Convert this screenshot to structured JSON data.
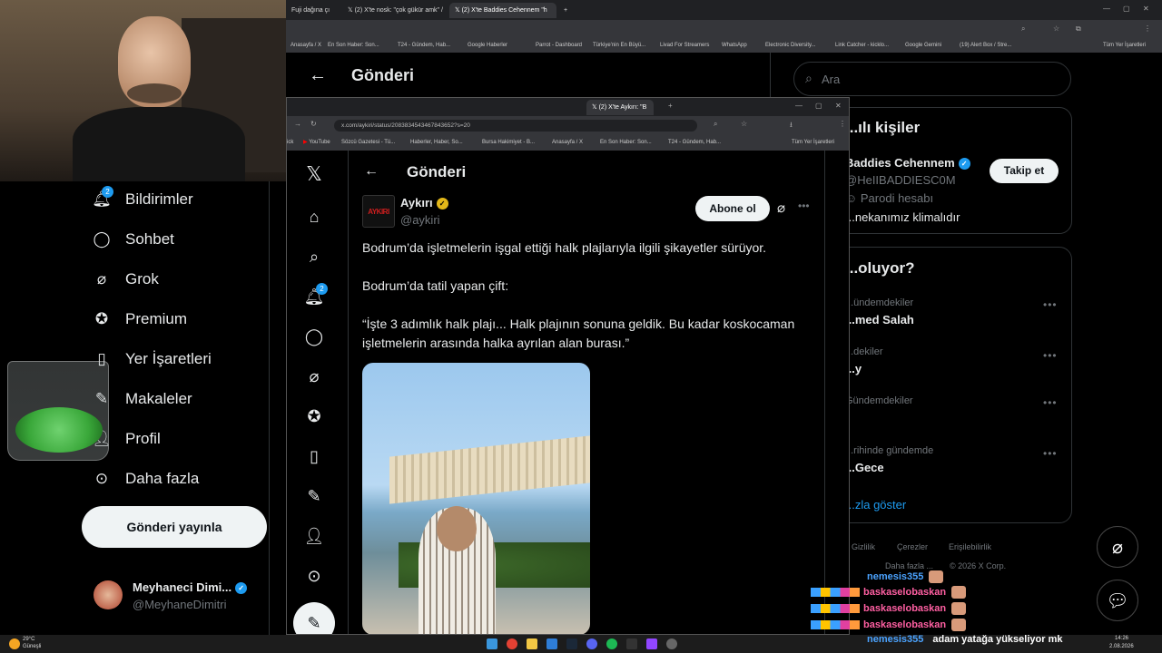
{
  "browser": {
    "tabs": [
      {
        "label": "Fuji dağına çı"
      },
      {
        "label": "(2) X'te nosk: \"çok gükür amk\" /"
      },
      {
        "label": "(2) X'te Baddies Cehennem \"h"
      }
    ],
    "bookmarks": [
      "Anasayfa / X",
      "En Son Haber: Son...",
      "T24 - Gündem, Hab...",
      "Google Haberler",
      "Parrot - Dashboard",
      "Türkiye'nin En Büyü...",
      "Livad For Streamers",
      "WhatsApp",
      "Electronic Diversity...",
      "Link Catcher - kicklo...",
      "Google Gemini",
      "(19) Alert Box / Stre..."
    ],
    "bookmarks_folder": "Tüm Yer İşaretleri"
  },
  "back_page": {
    "title": "Gönderi",
    "search_placeholder": "Ara",
    "who_to_follow": {
      "title": "...ılı kişiler",
      "name": "Baddies Cehennem",
      "handle": "@HeIIBADDIESC0M",
      "parody": "Parodi hesabı",
      "bio": "...nekanımız klimalıdır",
      "follow_label": "Takip et"
    },
    "trends": {
      "title": "...oluyor?",
      "items": [
        {
          "context": "...ündemdekiler",
          "name": "...med Salah"
        },
        {
          "context": "...dekiler",
          "name": "...y"
        },
        {
          "context": "Gündemdekiler",
          "name": ""
        },
        {
          "context": "...rihinde gündemde",
          "name": "...Gece"
        }
      ],
      "show_more": "...zla göster"
    },
    "footer": [
      "Gizlilik",
      "Çerezler",
      "Erişilebilirlik",
      "Daha fazla ...",
      "© 2026 X Corp."
    ]
  },
  "left_nav": {
    "items": [
      {
        "label": "Bildirimler",
        "icon": "bell-icon",
        "badge": "2"
      },
      {
        "label": "Sohbet",
        "icon": "chat-icon"
      },
      {
        "label": "Grok",
        "icon": "grok-icon"
      },
      {
        "label": "Premium",
        "icon": "premium-icon"
      },
      {
        "label": "Yer İşaretleri",
        "icon": "bookmark-icon"
      },
      {
        "label": "Makaleler",
        "icon": "article-icon"
      },
      {
        "label": "Profil",
        "icon": "person-icon"
      },
      {
        "label": "Daha fazla",
        "icon": "more-icon"
      }
    ],
    "post_button": "Gönderi yayınla",
    "profile": {
      "name": "Meyhaneci Dimi...",
      "handle": "@MeyhaneDimitri"
    }
  },
  "front_window": {
    "tab_label": "(2) X'te Aykırı: \"B",
    "url": "x.com/aykiri/status/2083834543467843652?s=20",
    "bookmarks": [
      "ick",
      "YouTube",
      "Sözcü Gazetesi - Tü...",
      "Haberler, Haber, So...",
      "Bursa Hakimiyet - B...",
      "Anasayfa / X",
      "En Son Haber: Son...",
      "T24 - Gündem, Hab..."
    ],
    "bookmarks_folder": "Tüm Yer İşaretleri",
    "nav_badge": "2",
    "header_title": "Gönderi",
    "post": {
      "avatar_text": "AYKIRI",
      "name": "Aykırı",
      "handle": "@aykiri",
      "subscribe_label": "Abone ol",
      "paragraphs": [
        "Bodrum’da işletmelerin işgal ettiği halk plajlarıyla ilgili şikayetler sürüyor.",
        "Bodrum’da tatil yapan çift:",
        "“İşte 3 adımlık halk plajı... Halk plajının sonuna geldik. Bu kadar koskocaman işletmelerin arasında halka ayrılan alan burası.”"
      ]
    }
  },
  "chat": [
    {
      "user": "nemesis355",
      "color": "#4ba3ff",
      "message": ""
    },
    {
      "user": "baskaselobaskan",
      "color": "#ff5fa2",
      "message": ""
    },
    {
      "user": "baskaselobaskan",
      "color": "#ff5fa2",
      "message": ""
    },
    {
      "user": "baskaselobaskan",
      "color": "#ff5fa2",
      "message": ""
    },
    {
      "user": "nemesis355",
      "color": "#4ba3ff",
      "message": "adam yatağa yükseliyor mk"
    }
  ],
  "taskbar": {
    "weather_temp": "29°C",
    "weather_desc": "Güneşli",
    "time": "14:26",
    "date": "2.08.2026"
  },
  "colors": {
    "accent": "#1d9bf0",
    "verified_gold": "#e2b719"
  }
}
